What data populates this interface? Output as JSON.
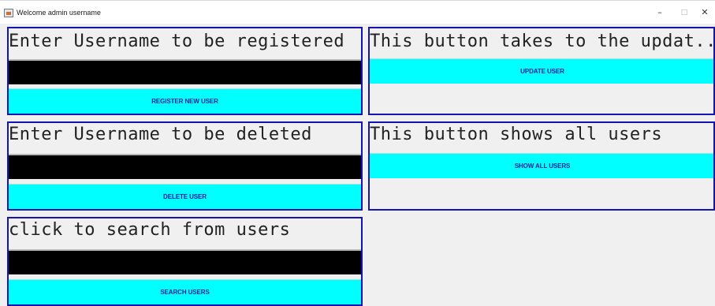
{
  "window": {
    "title": "Welcome admin username",
    "icon": "java-app-icon",
    "controls": {
      "minimize": "–",
      "maximize": "□",
      "close": "✕"
    }
  },
  "register": {
    "label": "Enter Username to be registered",
    "input_value": "",
    "button": "REGISTER NEW USER"
  },
  "update": {
    "label": "This button takes to the updat..",
    "button": "UPDATE USER"
  },
  "delete": {
    "label": "Enter Username to be deleted",
    "input_value": "",
    "button": "DELETE USER"
  },
  "show_all": {
    "label": "This button shows all users",
    "button": "SHOW ALL USERS"
  },
  "search": {
    "label": "click to search from users",
    "input_value": "",
    "button": "SEARCH USERS"
  },
  "colors": {
    "panel_border": "#1414b3",
    "button_bg": "#00ffff",
    "button_text": "#1a1aa0",
    "field_bg": "#000000",
    "window_bg": "#f0f0f0"
  }
}
